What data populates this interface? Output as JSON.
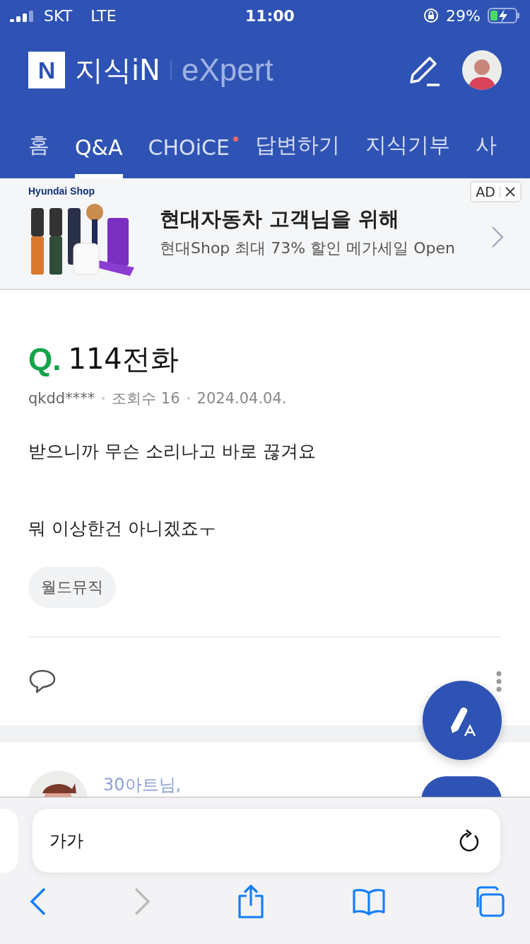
{
  "status_bar": {
    "carrier": "SKT",
    "network": "LTE",
    "time": "11:00",
    "battery": "29%"
  },
  "header": {
    "logo_mark": "N",
    "logo_text": "지식iN",
    "sub_brand": "eXpert"
  },
  "tabs": [
    {
      "label": "홈",
      "selected": false,
      "dot": false
    },
    {
      "label": "Q&A",
      "selected": true,
      "dot": false
    },
    {
      "label": "CHOiCE",
      "selected": false,
      "dot": true
    },
    {
      "label": "답변하기",
      "selected": false,
      "dot": false
    },
    {
      "label": "지식기부",
      "selected": false,
      "dot": false
    },
    {
      "label": "사",
      "selected": false,
      "dot": false
    }
  ],
  "ad": {
    "brand": "Hyundai Shop",
    "badge": "AD",
    "title": "현대자동차 고객님을 위해",
    "subtitle": "현대Shop 최대 73% 할인 메가세일 Open"
  },
  "question": {
    "mark": "Q.",
    "title": "114전화",
    "author": "qkdd****",
    "views": "조회수 16",
    "date": "2024.04.04.",
    "paragraphs": [
      "받으니까 무슨 소리나고 바로 끊겨요",
      "뭐 이상한건 아니겠죠ㅜ"
    ],
    "tags": [
      "월드뮤직"
    ]
  },
  "answer": {
    "name": "30아트님,"
  },
  "browser": {
    "address": "가가"
  }
}
